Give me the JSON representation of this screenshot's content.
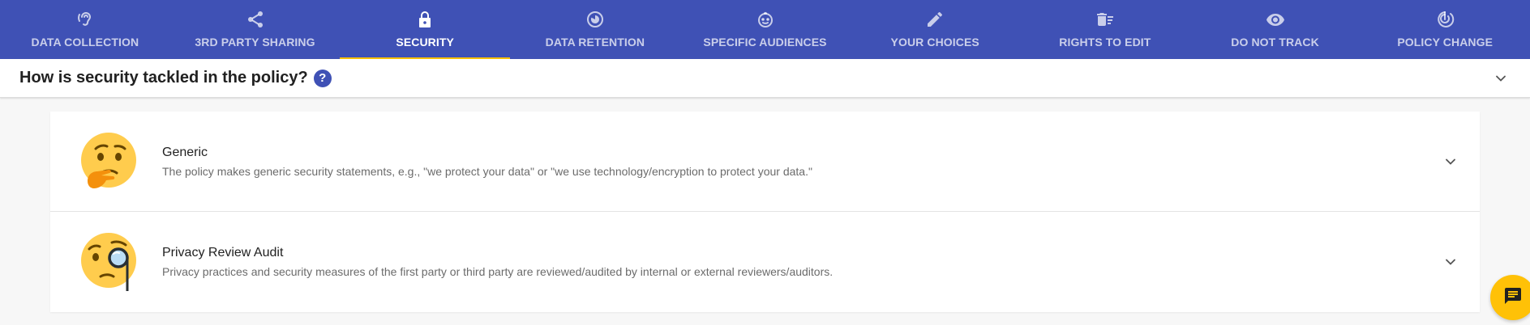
{
  "tabs": [
    {
      "label": "DATA COLLECTION",
      "icon": "ear-icon",
      "active": false
    },
    {
      "label": "3RD PARTY SHARING",
      "icon": "share-icon",
      "active": false
    },
    {
      "label": "SECURITY",
      "icon": "lock-icon",
      "active": true
    },
    {
      "label": "DATA RETENTION",
      "icon": "timelapse-icon",
      "active": false
    },
    {
      "label": "SPECIFIC AUDIENCES",
      "icon": "child-face-icon",
      "active": false
    },
    {
      "label": "YOUR CHOICES",
      "icon": "pencil-icon",
      "active": false
    },
    {
      "label": "RIGHTS TO EDIT",
      "icon": "delete-sweep-icon",
      "active": false
    },
    {
      "label": "DO NOT TRACK",
      "icon": "eye-icon",
      "active": false
    },
    {
      "label": "POLICY CHANGE",
      "icon": "track-changes-icon",
      "active": false
    }
  ],
  "question": {
    "title": "How is security tackled in the policy?",
    "help_symbol": "?"
  },
  "items": [
    {
      "title": "Generic",
      "description": "The policy makes generic security statements, e.g., \"we protect your data\" or \"we use technology/encryption to protect your data.\"",
      "icon": "thinking-face-emoji"
    },
    {
      "title": "Privacy Review Audit",
      "description": "Privacy practices and security measures of the first party or third party are reviewed/audited by internal or external reviewers/auditors.",
      "icon": "monocle-face-emoji"
    }
  ],
  "colors": {
    "tabbar": "#3f51b5",
    "active_indicator": "#ffc107",
    "fab": "#ffc107"
  }
}
